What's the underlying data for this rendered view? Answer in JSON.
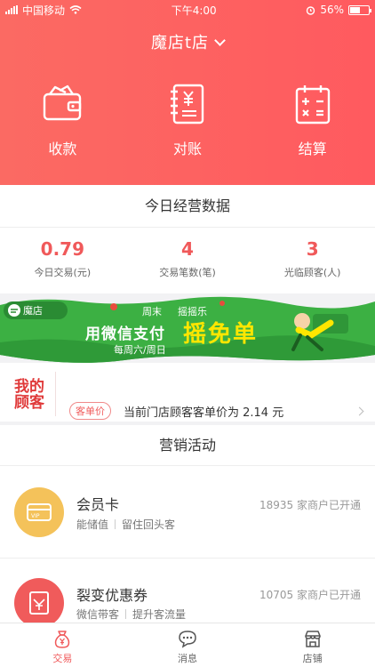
{
  "status_bar": {
    "carrier": "中国移动",
    "time": "下午4:00",
    "battery": "56%"
  },
  "header": {
    "store_name": "魔店t店"
  },
  "actions": [
    {
      "label": "收款",
      "icon": "wallet-icon"
    },
    {
      "label": "对账",
      "icon": "ledger-icon"
    },
    {
      "label": "结算",
      "icon": "calculator-icon"
    }
  ],
  "today": {
    "title": "今日经营数据",
    "stats": [
      {
        "value": "0.79",
        "label": "今日交易(元)"
      },
      {
        "value": "4",
        "label": "交易笔数(笔)"
      },
      {
        "value": "3",
        "label": "光临顾客(人)"
      }
    ]
  },
  "banner": {
    "brand": "魔店",
    "line1": "周末",
    "line1b": "摇摇乐",
    "line2": "用微信支付",
    "line3": "每周六/周日",
    "highlight": "摇免单"
  },
  "customers": {
    "logo_line1": "我的",
    "logo_line2": "顾客",
    "rows": [
      {
        "tag": "客单价",
        "text": "当前门店顾客客单价为 2.14 元"
      }
    ]
  },
  "marketing": {
    "title": "营销活动",
    "items": [
      {
        "name": "会员卡",
        "tags": [
          "能储值",
          "留住回头客"
        ],
        "count": "18935 家商户已开通"
      },
      {
        "name": "裂变优惠券",
        "tags": [
          "微信带客",
          "提升客流量"
        ],
        "count": "10705 家商户已开通"
      }
    ]
  },
  "tabbar": [
    {
      "label": "交易",
      "icon": "money-bag-icon",
      "active": true
    },
    {
      "label": "消息",
      "icon": "chat-bubble-icon",
      "active": false
    },
    {
      "label": "店铺",
      "icon": "store-icon",
      "active": false
    }
  ],
  "colors": {
    "primary": "#ff5a5f",
    "accent_text": "#f0595a",
    "banner_green": "#3cb043",
    "card_yellow": "#f4c25a"
  }
}
